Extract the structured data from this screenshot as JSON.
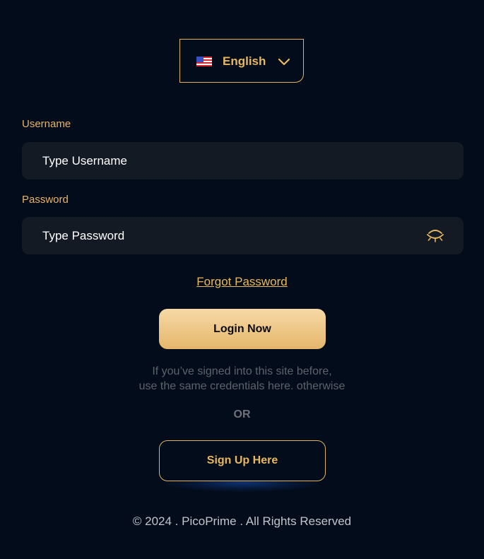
{
  "language": {
    "label": "English",
    "flag_icon": "us-flag-icon",
    "dropdown_icon": "chevron-down-icon"
  },
  "username": {
    "label": "Username",
    "placeholder": "Type Username"
  },
  "password": {
    "label": "Password",
    "placeholder": "Type Password",
    "toggle_icon": "eye-closed-icon"
  },
  "forgot_password": "Forgot Password",
  "login_button": "Login Now",
  "hint": {
    "line1": "If you’ve signed into this site before,",
    "line2": "use the same credentials here. otherwise"
  },
  "or_text": "OR",
  "signup_button": "Sign Up Here",
  "footer": "© 2024 . PicoPrime . All Rights Reserved",
  "colors": {
    "background": "#020c1b",
    "accent": "#e9b85e",
    "input_bg": "#141a24",
    "muted_text": "#5e636b"
  }
}
